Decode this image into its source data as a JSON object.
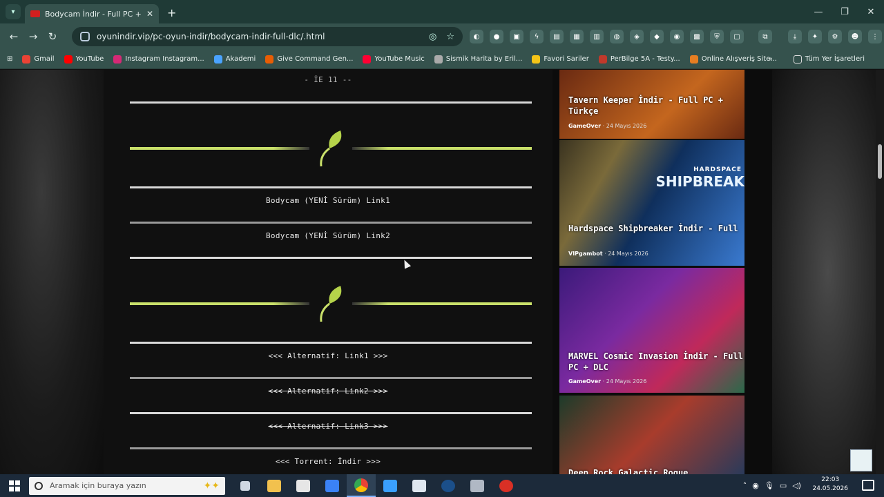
{
  "browser": {
    "tab_title": "Bodycam İndir - Full PC + DLC",
    "url": "oyunindir.vip/pc-oyun-indir/bodycam-indir-full-dlc/.html",
    "bookmarks": [
      {
        "label": "Gmail",
        "color": "#ea4335"
      },
      {
        "label": "YouTube",
        "color": "#ff0000"
      },
      {
        "label": "Instagram Instagram...",
        "color": "#d62976"
      },
      {
        "label": "Akademi",
        "color": "#4aa3ff"
      },
      {
        "label": "Give Command Gen...",
        "color": "#e85d04"
      },
      {
        "label": "YouTube Music",
        "color": "#ff0033"
      },
      {
        "label": "Sismik Harita by Eril...",
        "color": "#aaaaaa"
      },
      {
        "label": "Favori Sariler",
        "color": "#f5c518"
      },
      {
        "label": "PerBilge 5A - Testy...",
        "color": "#c0392b"
      },
      {
        "label": "Online Alışveriş Site...",
        "color": "#e67e22"
      }
    ],
    "bookmarks_more": "»",
    "all_bookmarks": "Tüm Yer İşaretleri",
    "window_controls": [
      "—",
      "❐",
      "✕"
    ]
  },
  "content": {
    "top_text": "- İE 11 --",
    "link1": "Bodycam (YENİ Sürüm) Link1",
    "link2": "Bodycam (YENİ Sürüm) Link2",
    "alt1": "<<< Alternatif: Link1 >>>",
    "alt2": "<<< Alternatif: Link2 >>>",
    "alt3": "<<< Alternatif: Link3 >>>",
    "torrent": "<<< Torrent: İndir >>>"
  },
  "sidebar": {
    "cards": [
      {
        "title": "Tavern Keeper İndir - Full PC + Türkçe",
        "author": "GameOver",
        "date": "24 Mayıs 2026",
        "colors": [
          "#6a2a12",
          "#c4661e"
        ]
      },
      {
        "title": "Hardspace Shipbreaker İndir - Full",
        "author": "VIPgambot",
        "date": "24 Mayıs 2026",
        "banner": "SHIPBREAK",
        "banner_sub": "HARDSPACE",
        "colors": [
          "#0f2f5c",
          "#3a7ad0"
        ]
      },
      {
        "title": "MARVEL Cosmic Invasion İndir - Full PC + DLC",
        "author": "GameOver",
        "date": "24 Mayıs 2026",
        "colors": [
          "#3b1a7a",
          "#c0295a"
        ]
      },
      {
        "title": "Deep Rock Galactic Rogue",
        "author": "",
        "date": "",
        "colors": [
          "#1c3b2a",
          "#a83c2c"
        ]
      }
    ]
  },
  "taskbar": {
    "search_placeholder": "Aramak için buraya yazın",
    "apps": [
      {
        "name": "task-view",
        "color": "#cfd8e3"
      },
      {
        "name": "file-explorer",
        "color": "#f2c14e"
      },
      {
        "name": "store",
        "color": "#e6e6e6"
      },
      {
        "name": "mail",
        "color": "#3b82f6"
      },
      {
        "name": "chrome",
        "color": "#34a853"
      },
      {
        "name": "vs-code",
        "color": "#3aa0ff"
      },
      {
        "name": "files",
        "color": "#dfe7f0"
      },
      {
        "name": "steam",
        "color": "#1b4f8a"
      },
      {
        "name": "app",
        "color": "#b0b8c4"
      },
      {
        "name": "recorder",
        "color": "#d93025"
      }
    ],
    "time": "22:03",
    "date": "24.05.2026"
  }
}
